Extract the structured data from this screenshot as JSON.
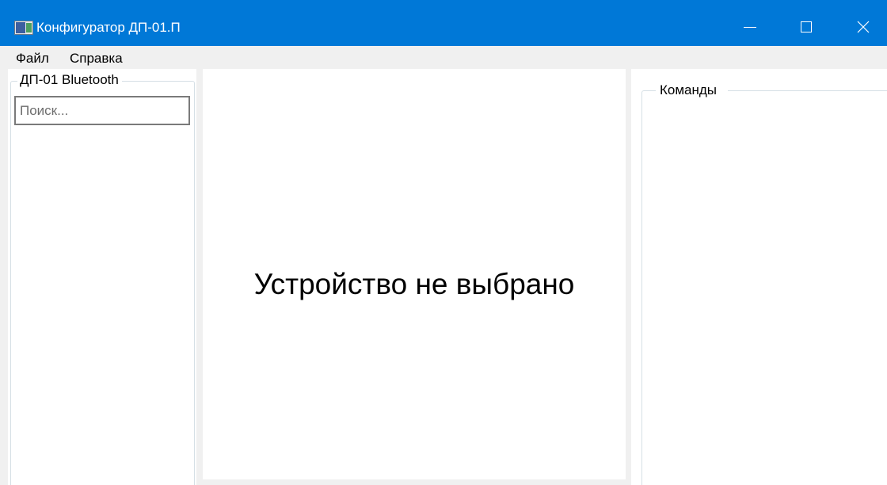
{
  "window": {
    "title": "Конфигуратор ДП-01.П",
    "accent_color": "#0078d7",
    "app_icon": "app-window-icon",
    "controls": {
      "minimize_icon": "minimize-icon",
      "maximize_icon": "maximize-icon",
      "close_icon": "close-icon",
      "close_glyph": "✕"
    }
  },
  "menu": {
    "items": [
      {
        "label": "Файл"
      },
      {
        "label": "Справка"
      }
    ]
  },
  "devices_panel": {
    "group_title": "ДП-01 Bluetooth",
    "search": {
      "value": "",
      "placeholder": "Поиск..."
    }
  },
  "main": {
    "empty_message": "Устройство не выбрано"
  },
  "commands_panel": {
    "group_title": "Команды"
  }
}
